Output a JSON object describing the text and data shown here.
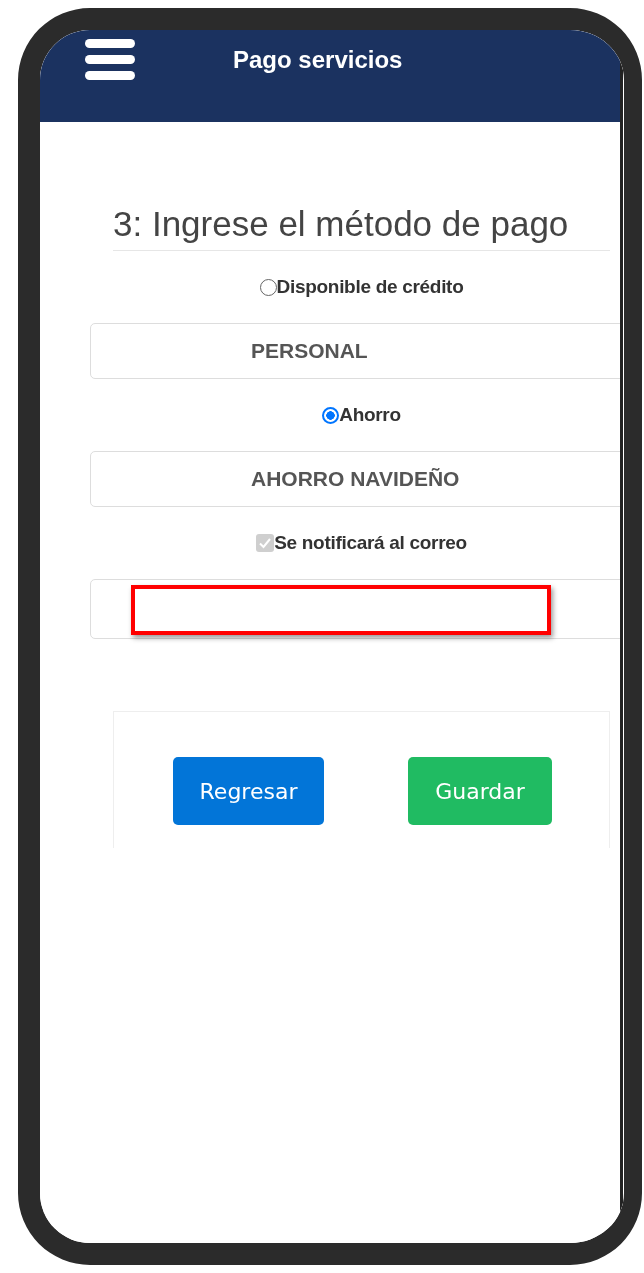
{
  "header": {
    "title": "Pago servicios"
  },
  "heading": "3: Ingrese el método de pago",
  "options": [
    {
      "kind": "radio",
      "label": "Disponible de crédito",
      "selected": false
    },
    {
      "kind": "field",
      "value": "PERSONAL"
    },
    {
      "kind": "radio",
      "label": "Ahorro",
      "selected": true
    },
    {
      "kind": "field",
      "value": "AHORRO NAVIDEÑO"
    },
    {
      "kind": "checkbox",
      "label": "Se notificará al correo",
      "checked": true,
      "disabled": true
    },
    {
      "kind": "redacted_field"
    }
  ],
  "buttons": [
    {
      "kind": "back",
      "label": "Regresar"
    },
    {
      "kind": "save",
      "label": "Guardar"
    }
  ]
}
